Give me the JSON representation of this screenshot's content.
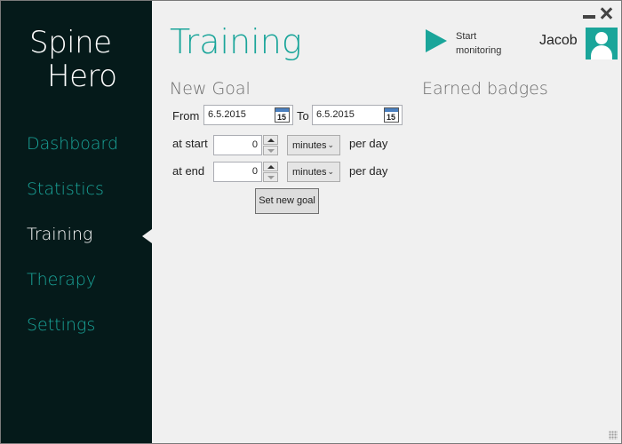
{
  "app": {
    "logo_line1": "Spine",
    "logo_line2": "Hero"
  },
  "sidebar": {
    "items": [
      {
        "label": "Dashboard",
        "active": false
      },
      {
        "label": "Statistics",
        "active": false
      },
      {
        "label": "Training",
        "active": true
      },
      {
        "label": "Therapy",
        "active": false
      },
      {
        "label": "Settings",
        "active": false
      }
    ]
  },
  "header": {
    "title": "Training",
    "start_monitoring_line1": "Start",
    "start_monitoring_line2": "monitoring",
    "user_name": "Jacob"
  },
  "new_goal": {
    "title": "New Goal",
    "from_label": "From",
    "from_value": "6.5.2015",
    "to_label": "To",
    "to_value": "6.5.2015",
    "calendar_day": "15",
    "at_start_label": "at start",
    "at_start_value": "0",
    "at_start_unit": "minutes",
    "at_end_label": "at end",
    "at_end_value": "0",
    "at_end_unit": "minutes",
    "per_day_label": "per day",
    "set_goal_button": "Set new goal"
  },
  "badges": {
    "title": "Earned badges"
  },
  "colors": {
    "accent": "#1aa59a",
    "sidebar_bg": "#051a1a",
    "content_bg": "#f0f0f0"
  },
  "icons": [
    "play-icon",
    "user-icon",
    "calendar-icon",
    "minimize-icon",
    "close-icon",
    "chevron-down-icon"
  ]
}
